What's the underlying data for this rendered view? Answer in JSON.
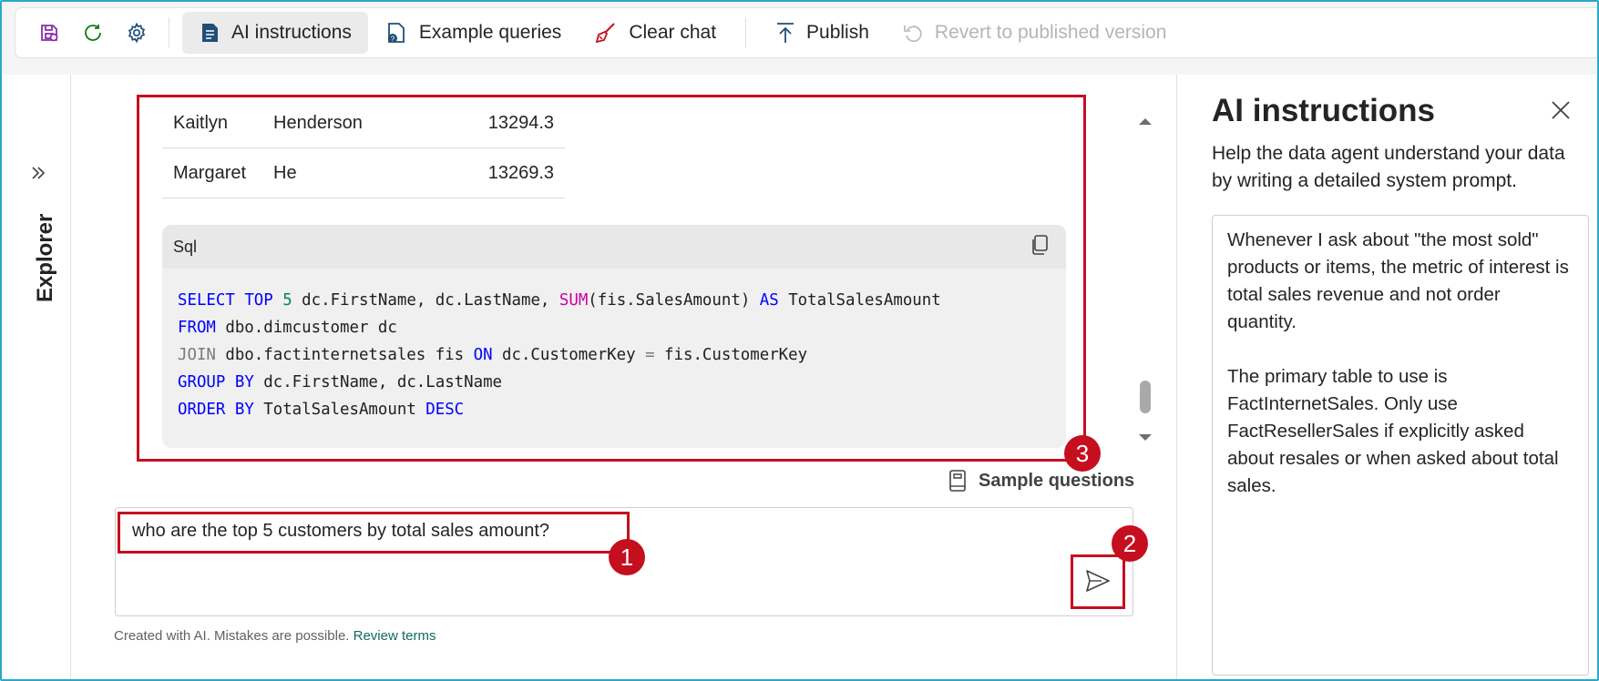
{
  "toolbar": {
    "icons": [
      "save-icon",
      "refresh-icon",
      "gear-icon"
    ],
    "ai_instructions": "AI instructions",
    "example_queries": "Example queries",
    "clear_chat": "Clear chat",
    "publish": "Publish",
    "revert": "Revert to published version"
  },
  "explorer": {
    "label": "Explorer"
  },
  "result_table": {
    "rows": [
      [
        "Kaitlyn",
        "Henderson",
        "13294.3"
      ],
      [
        "Margaret",
        "He",
        "13269.3"
      ]
    ]
  },
  "code": {
    "language": "Sql",
    "lines": [
      [
        {
          "t": "SELECT",
          "c": "kw"
        },
        {
          "t": " "
        },
        {
          "t": "TOP",
          "c": "kw"
        },
        {
          "t": " "
        },
        {
          "t": "5",
          "c": "num"
        },
        {
          "t": " dc.FirstName, dc.LastName, "
        },
        {
          "t": "SUM",
          "c": "fn"
        },
        {
          "t": "(fis.SalesAmount) "
        },
        {
          "t": "AS",
          "c": "kw"
        },
        {
          "t": " TotalSalesAmount"
        }
      ],
      [
        {
          "t": "FROM",
          "c": "kw"
        },
        {
          "t": " dbo.dimcustomer dc"
        }
      ],
      [
        {
          "t": "JOIN",
          "c": "gr"
        },
        {
          "t": " dbo.factinternetsales fis "
        },
        {
          "t": "ON",
          "c": "kw"
        },
        {
          "t": " dc.CustomerKey "
        },
        {
          "t": "=",
          "c": "gr"
        },
        {
          "t": " fis.CustomerKey"
        }
      ],
      [
        {
          "t": "GROUP",
          "c": "kw"
        },
        {
          "t": " "
        },
        {
          "t": "BY",
          "c": "kw"
        },
        {
          "t": " dc.FirstName, dc.LastName"
        }
      ],
      [
        {
          "t": "ORDER",
          "c": "kw"
        },
        {
          "t": " "
        },
        {
          "t": "BY",
          "c": "kw"
        },
        {
          "t": " TotalSalesAmount "
        },
        {
          "t": "DESC",
          "c": "kw"
        }
      ]
    ]
  },
  "sample_questions": "Sample questions",
  "input": {
    "value": "who are the top 5 customers by total sales amount?"
  },
  "disclaimer": {
    "text": "Created with AI. Mistakes are possible.",
    "link": "Review terms"
  },
  "callouts": {
    "one": "1",
    "two": "2",
    "three": "3"
  },
  "ai_panel": {
    "title": "AI instructions",
    "subtitle": "Help the data agent understand your data by writing a detailed system prompt.",
    "instructions": "Whenever I ask about \"the most sold\" products or items, the metric of interest is total sales revenue and not order quantity.\n\nThe primary table to use is FactInternetSales. Only use FactResellerSales if explicitly asked about resales or when asked about total sales."
  },
  "colors": {
    "accent": "#0f6c5a",
    "callout": "#c50f1f",
    "border": "#2aa8c8"
  }
}
